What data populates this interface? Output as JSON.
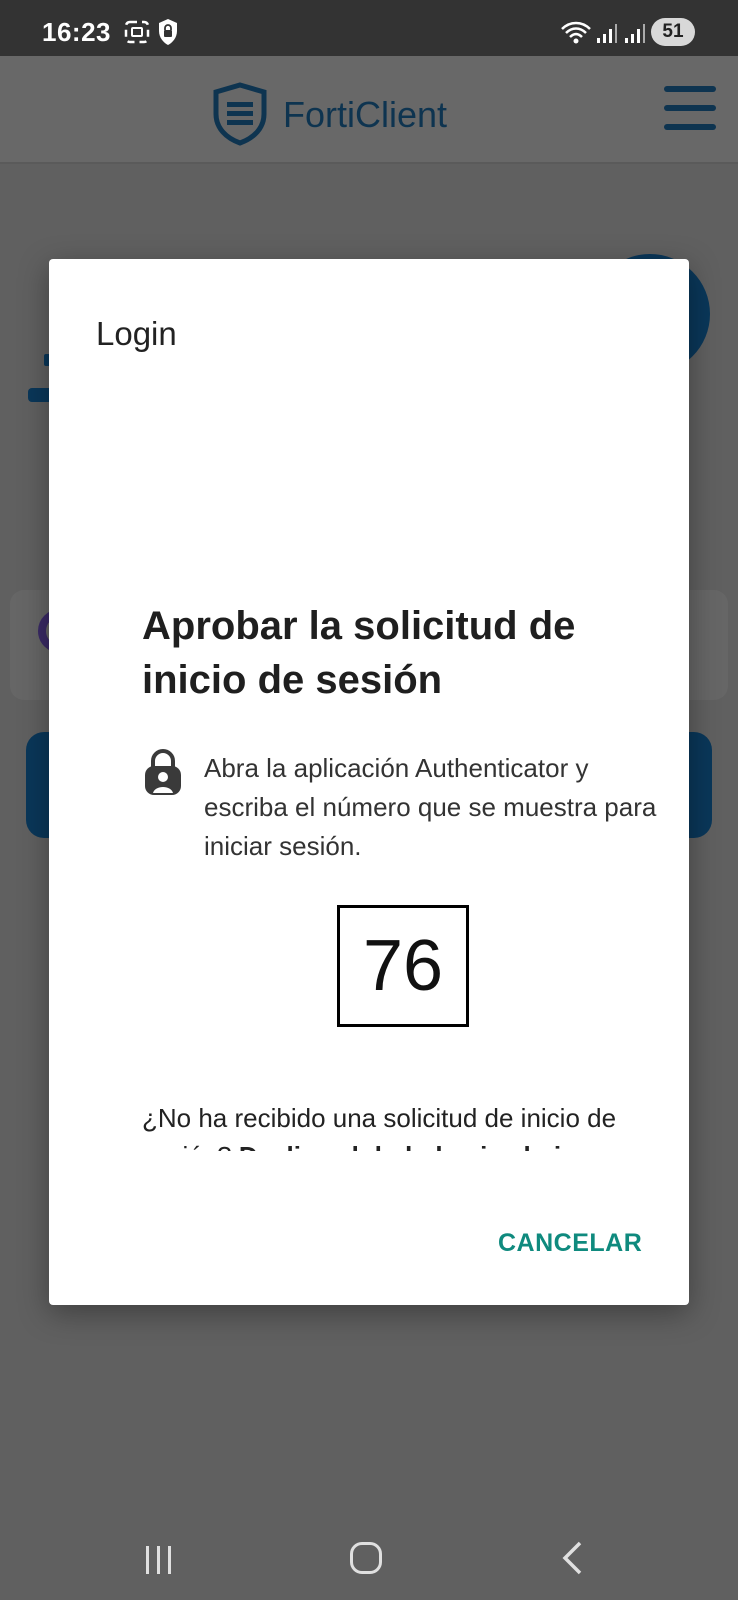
{
  "status_bar": {
    "time": "16:23",
    "battery": "51"
  },
  "app_header": {
    "brand": "FortiClient",
    "brand_color": "#0e3450"
  },
  "dialog": {
    "title": "Login",
    "heading": "Aprobar la solicitud de inicio de sesión",
    "instruction": "Abra la aplicación Authenticator y escriba el número que se muestra para iniciar sesión.",
    "number": "76",
    "help_text": "¿No ha recibido una solicitud de inicio de sesión?",
    "help_bold": "Deslice el dedo hacia abajo",
    "cancel_label": "CANCELAR",
    "accent_color": "#0f8a7e"
  },
  "icons": {
    "lock": "lock-person-icon",
    "menu": "hamburger-menu-icon",
    "logo": "forticlient-shield-logo"
  }
}
